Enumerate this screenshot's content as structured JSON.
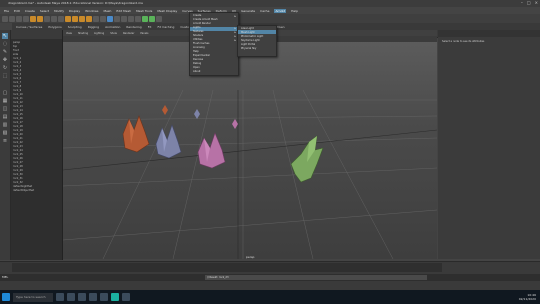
{
  "window": {
    "title": "dragonlizard.ma* - Autodesk Maya 2018.1: Educational Version: D:\\Maya\\dragonlizard.ma"
  },
  "menubar": [
    "File",
    "Edit",
    "Create",
    "Select",
    "Modify",
    "Display",
    "Windows",
    "Mesh",
    "Edit Mesh",
    "Mesh Tools",
    "Mesh Display",
    "Curves",
    "Surfaces",
    "Deform",
    "UV",
    "Generate",
    "Cache",
    "Arnold",
    "Help"
  ],
  "shelf_tabs": [
    "Curves / Surfaces",
    "Polygons",
    "Sculpting",
    "Rigging",
    "Animation",
    "Rendering",
    "FX",
    "FX Caching",
    "Custom",
    "Arnold",
    "Bifrost",
    "MASH",
    "Motion Graphics",
    "XGen"
  ],
  "viewport_menu": [
    "View",
    "Shading",
    "Lighting",
    "Show",
    "Renderer",
    "Panels"
  ],
  "viewport_label": "persp",
  "outliner_items": [
    "persp",
    "top",
    "front",
    "side",
    "rock_1",
    "rock_2",
    "rock_3",
    "rock_4",
    "rock_5",
    "rock_6",
    "rock_7",
    "rock_8",
    "rock_9",
    "rock_10",
    "rock_11",
    "rock_12",
    "rock_13",
    "rock_14",
    "rock_15",
    "rock_16",
    "rock_17",
    "rock_18",
    "rock_19",
    "rock_20",
    "rock_21",
    "rock_22",
    "rock_23",
    "rock_24",
    "rock_25",
    "rock_26",
    "rock_27",
    "rock_28",
    "rock_29",
    "rock_30",
    "rock_31",
    "rock_32",
    "defaultLightSet",
    "defaultObjectSet"
  ],
  "dropdown_main": [
    "Create",
    "Create Arnold Mesh",
    "Arnold Render",
    "Lights",
    "Textures",
    "Shaders",
    "Utilities",
    "Flush Caches",
    "Licensing",
    "Help",
    "Experimental",
    "Denoise",
    "Debug",
    "Open",
    "About"
  ],
  "dropdown_sub": [
    "Area Light",
    "Mesh Light",
    "Photometric Light",
    "Skydome Light",
    "Light Portal",
    "Physical Sky"
  ],
  "attribute_message": "Select a node to see its attributes",
  "command_line": {
    "label": "MEL",
    "result": "// Result: rock_23"
  },
  "taskbar": {
    "search": "Type here to search",
    "time": "10:46",
    "date": "02/11/2020"
  },
  "colors": {
    "accent": "#5285a6",
    "maya_logo": "#23c1a8"
  }
}
